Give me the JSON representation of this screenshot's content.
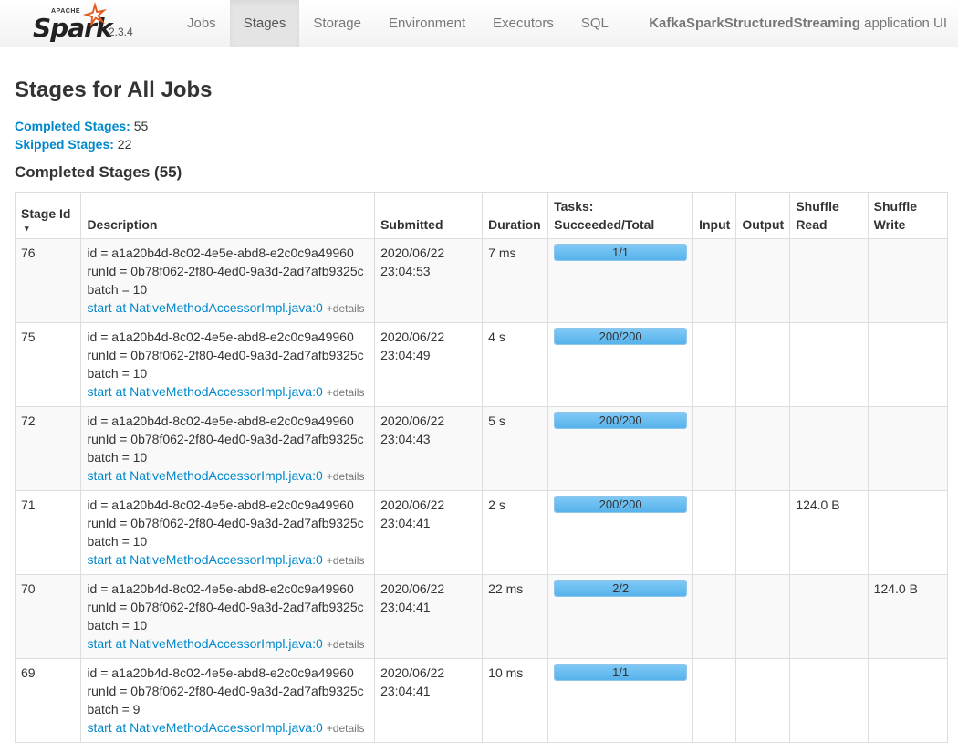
{
  "brand": {
    "apache": "APACHE",
    "logo_text": "Spark",
    "version": "2.3.4"
  },
  "nav": {
    "items": [
      {
        "label": "Jobs"
      },
      {
        "label": "Stages",
        "active": true
      },
      {
        "label": "Storage"
      },
      {
        "label": "Environment"
      },
      {
        "label": "Executors"
      },
      {
        "label": "SQL"
      }
    ]
  },
  "app": {
    "name": "KafkaSparkStructuredStreaming",
    "suffix": " application UI"
  },
  "page": {
    "title": "Stages for All Jobs",
    "completed_label": "Completed Stages:",
    "completed_count": " 55",
    "skipped_label": "Skipped Stages:",
    "skipped_count": " 22",
    "section_title": "Completed Stages (55)"
  },
  "table": {
    "headers": {
      "stage_id": "Stage Id",
      "sort_arrow": "▾",
      "description": "Description",
      "submitted": "Submitted",
      "duration": "Duration",
      "tasks_line1": "Tasks:",
      "tasks_line2": "Succeeded/Total",
      "input": "Input",
      "output": "Output",
      "shuffle_read_1": "Shuffle",
      "shuffle_read_2": "Read",
      "shuffle_write_1": "Shuffle",
      "shuffle_write_2": "Write"
    },
    "rows": [
      {
        "stage_id": "76",
        "id_line": "id = a1a20b4d-8c02-4e5e-abd8-e2c0c9a49960",
        "runid_line": "runId = 0b78f062-2f80-4ed0-9a3d-2ad7afb9325c",
        "batch_line": "batch = 10",
        "link": "start at NativeMethodAccessorImpl.java:0",
        "details": "+details",
        "submitted_date": "2020/06/22",
        "submitted_time": "23:04:53",
        "duration": "7 ms",
        "tasks": "1/1",
        "tasks_fraction": 1.0,
        "input": "",
        "output": "",
        "shuffle_read": "",
        "shuffle_write": ""
      },
      {
        "stage_id": "75",
        "id_line": "id = a1a20b4d-8c02-4e5e-abd8-e2c0c9a49960",
        "runid_line": "runId = 0b78f062-2f80-4ed0-9a3d-2ad7afb9325c",
        "batch_line": "batch = 10",
        "link": "start at NativeMethodAccessorImpl.java:0",
        "details": "+details",
        "submitted_date": "2020/06/22",
        "submitted_time": "23:04:49",
        "duration": "4 s",
        "tasks": "200/200",
        "tasks_fraction": 1.0,
        "input": "",
        "output": "",
        "shuffle_read": "",
        "shuffle_write": ""
      },
      {
        "stage_id": "72",
        "id_line": "id = a1a20b4d-8c02-4e5e-abd8-e2c0c9a49960",
        "runid_line": "runId = 0b78f062-2f80-4ed0-9a3d-2ad7afb9325c",
        "batch_line": "batch = 10",
        "link": "start at NativeMethodAccessorImpl.java:0",
        "details": "+details",
        "submitted_date": "2020/06/22",
        "submitted_time": "23:04:43",
        "duration": "5 s",
        "tasks": "200/200",
        "tasks_fraction": 1.0,
        "input": "",
        "output": "",
        "shuffle_read": "",
        "shuffle_write": ""
      },
      {
        "stage_id": "71",
        "id_line": "id = a1a20b4d-8c02-4e5e-abd8-e2c0c9a49960",
        "runid_line": "runId = 0b78f062-2f80-4ed0-9a3d-2ad7afb9325c",
        "batch_line": "batch = 10",
        "link": "start at NativeMethodAccessorImpl.java:0",
        "details": "+details",
        "submitted_date": "2020/06/22",
        "submitted_time": "23:04:41",
        "duration": "2 s",
        "tasks": "200/200",
        "tasks_fraction": 1.0,
        "input": "",
        "output": "",
        "shuffle_read": "124.0 B",
        "shuffle_write": ""
      },
      {
        "stage_id": "70",
        "id_line": "id = a1a20b4d-8c02-4e5e-abd8-e2c0c9a49960",
        "runid_line": "runId = 0b78f062-2f80-4ed0-9a3d-2ad7afb9325c",
        "batch_line": "batch = 10",
        "link": "start at NativeMethodAccessorImpl.java:0",
        "details": "+details",
        "submitted_date": "2020/06/22",
        "submitted_time": "23:04:41",
        "duration": "22 ms",
        "tasks": "2/2",
        "tasks_fraction": 1.0,
        "input": "",
        "output": "",
        "shuffle_read": "",
        "shuffle_write": "124.0 B"
      },
      {
        "stage_id": "69",
        "id_line": "id = a1a20b4d-8c02-4e5e-abd8-e2c0c9a49960",
        "runid_line": "runId = 0b78f062-2f80-4ed0-9a3d-2ad7afb9325c",
        "batch_line": "batch = 9",
        "link": "start at NativeMethodAccessorImpl.java:0",
        "details": "+details",
        "submitted_date": "2020/06/22",
        "submitted_time": "23:04:41",
        "duration": "10 ms",
        "tasks": "1/1",
        "tasks_fraction": 1.0,
        "input": "",
        "output": "",
        "shuffle_read": "",
        "shuffle_write": ""
      }
    ]
  },
  "colors": {
    "link": "#0088cc",
    "progress_bar": "#5ab6ee",
    "active_tab_bg": "#e4e4e4",
    "spark_star": "#e25a1c"
  },
  "icons": {
    "logo": "spark-star-icon",
    "sort": "sort-desc-icon"
  }
}
